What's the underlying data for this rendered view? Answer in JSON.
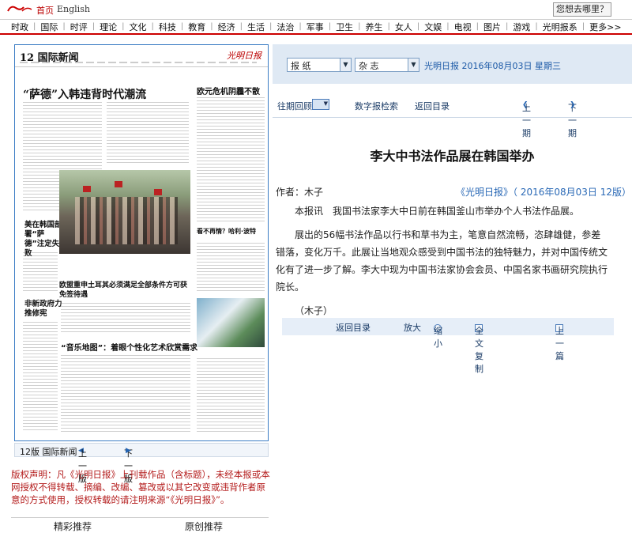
{
  "header": {
    "home": "首页",
    "english": "English",
    "where_button": "您想去哪里？"
  },
  "nav": [
    "时政",
    "国际",
    "时评",
    "理论",
    "文化",
    "科技",
    "教育",
    "经济",
    "生活",
    "法治",
    "军事",
    "卫生",
    "养生",
    "女人",
    "文娱",
    "电视",
    "图片",
    "游戏",
    "光明报系",
    "更多>>"
  ],
  "paper": {
    "page_label": "12 国际新闻",
    "paper_name": "光明日报",
    "headline_main": "“萨德”入韩违背时代潮流",
    "headline_right": "欧元危机阴霾不散",
    "headline_side": "美在韩国部署“萨德”注定失败",
    "headline_mid1": "欧盟重申土耳其必须满足全部条件方可获免签待遇",
    "headline_side2": "非新政府力推修宪",
    "headline_mid2": "“音乐地图”：着眼个性化艺术欣赏需求",
    "headline_rs": "看不再情？哈利·波特"
  },
  "pagebar": {
    "edition": "12版 国际新闻",
    "prev": "上一版",
    "next": "下一版"
  },
  "copyright": "版权声明：凡《光明日报》上刊载作品（含标题），未经本报或本网授权不得转载、摘编、改编、篡改或以其它改变或违背作者原意的方式使用，授权转载的请注明来源“《光明日报》”。",
  "bottom_tabs": [
    "精彩推荐",
    "原创推荐"
  ],
  "selectors": {
    "paper": "报 纸",
    "magazine": "杂 志",
    "date_info": "光明日报  2016年08月03日  星期三"
  },
  "toolbar": {
    "past": "往期回顾",
    "search": "数字报检索",
    "back": "返回目录",
    "prev_issue": "上一期",
    "next_issue": "下一期"
  },
  "article": {
    "title": "李大中书法作品展在韩国举办",
    "author": "作者：木子",
    "source": "《光明日报》（ 2016年08月03日   12版）",
    "paragraphs": [
      "本报讯　我国书法家李大中日前在韩国釜山市举办个人书法作品展。",
      "展出的56幅书法作品以行书和草书为主，笔意自然流畅，恣肆雄健，参差错落，变化万千。此展让当地观众感受到中国书法的独特魅力，并对中国传统文化有了进一步了解。李大中现为中国书法家协会会员、中国名家书画研究院执行院长。",
      "（木子）"
    ]
  },
  "article_bar": {
    "back": "返回目录",
    "enlarge": "放大",
    "shrink": "缩小",
    "copy_all": "全文复制",
    "prev_article": "上一篇"
  },
  "colors": {
    "accent_red": "#c00000",
    "link_blue": "#2a69b6",
    "panel_bg": "#dfe9f4"
  }
}
